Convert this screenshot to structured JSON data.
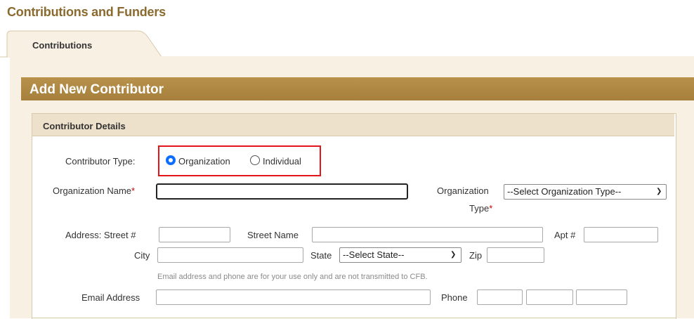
{
  "page": {
    "title": "Contributions and Funders"
  },
  "tabs": [
    {
      "label": "Contributions",
      "active": true
    }
  ],
  "panel": {
    "title": "Add New Contributor"
  },
  "section": {
    "title": "Contributor Details"
  },
  "form": {
    "contributor_type": {
      "label": "Contributor Type:",
      "options": [
        {
          "label": "Organization",
          "selected": true
        },
        {
          "label": "Individual",
          "selected": false
        }
      ]
    },
    "organization_name": {
      "label": "Organization Name",
      "required_mark": "*",
      "value": ""
    },
    "organization_type": {
      "label_line1": "Organization",
      "label_line2": "Type",
      "required_mark": "*",
      "selected": "--Select Organization Type--"
    },
    "street_number": {
      "label": "Address: Street #",
      "value": ""
    },
    "street_name": {
      "label": "Street Name",
      "value": ""
    },
    "apt": {
      "label": "Apt #",
      "value": ""
    },
    "city": {
      "label": "City",
      "value": ""
    },
    "state": {
      "label": "State",
      "selected": "--Select State--"
    },
    "zip": {
      "label": "Zip",
      "value": ""
    },
    "note": "Email address and phone are for your use only and are not transmitted to CFB.",
    "email": {
      "label": "Email Address",
      "value": ""
    },
    "phone": {
      "label": "Phone",
      "area": "",
      "prefix": "",
      "line": ""
    }
  },
  "colors": {
    "brand": "#8a6a2e",
    "panel_header": "#a6803c",
    "section_header": "#eee1cb",
    "content_bg": "#f8f0e3",
    "highlight": "#e2151b",
    "radio": "#0d6efd"
  }
}
